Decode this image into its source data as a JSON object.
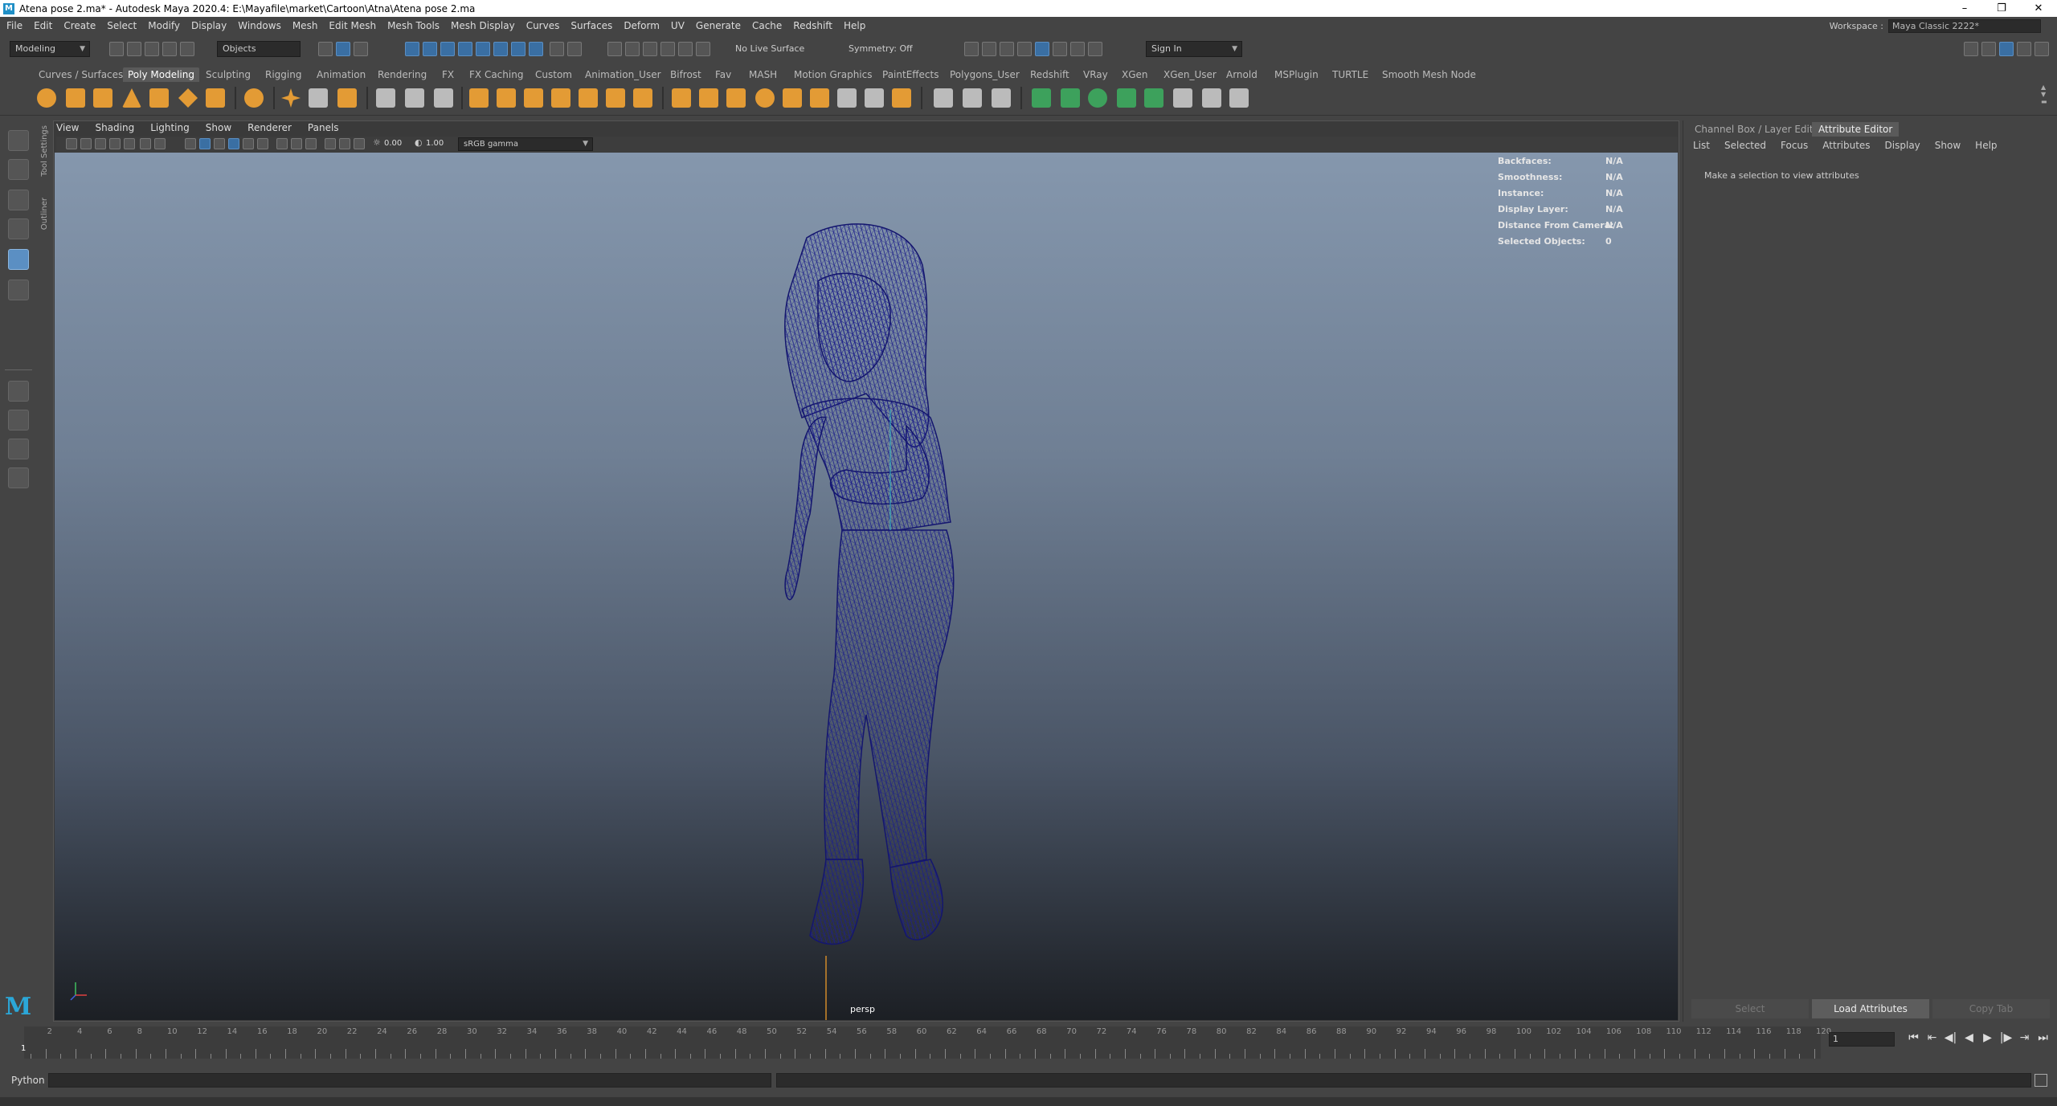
{
  "window": {
    "title": "Atena pose 2.ma* - Autodesk Maya 2020.4: E:\\Mayafile\\market\\Cartoon\\Atna\\Atena pose 2.ma",
    "logo": "M",
    "controls": [
      "–",
      "❐",
      "✕"
    ]
  },
  "menubar": {
    "items": [
      "File",
      "Edit",
      "Create",
      "Select",
      "Modify",
      "Display",
      "Windows",
      "Mesh",
      "Edit Mesh",
      "Mesh Tools",
      "Mesh Display",
      "Curves",
      "Surfaces",
      "Deform",
      "UV",
      "Generate",
      "Cache",
      "Redshift",
      "Help"
    ],
    "workspace_label": "Workspace :",
    "workspace_value": "Maya Classic 2222*"
  },
  "statusline": {
    "menuset": "Modeling",
    "selection_mode": "Objects",
    "live_surface": "No Live Surface",
    "symmetry": "Symmetry: Off",
    "sign_in": "Sign In"
  },
  "shelf": {
    "tabs": [
      "Curves / Surfaces",
      "Poly Modeling",
      "Sculpting",
      "Rigging",
      "Animation",
      "Rendering",
      "FX",
      "FX Caching",
      "Custom",
      "Animation_User",
      "Bifrost",
      "Fav",
      "MASH",
      "Motion Graphics",
      "PaintEffects",
      "Polygons_User",
      "Redshift",
      "VRay",
      "XGen",
      "XGen_User",
      "Arnold",
      "MSPlugin",
      "TURTLE",
      "Smooth Mesh Node"
    ],
    "active_tab": "Poly Modeling"
  },
  "sidetabs": [
    "Tool Settings",
    "Outliner"
  ],
  "viewport": {
    "menu": [
      "View",
      "Shading",
      "Lighting",
      "Show",
      "Renderer",
      "Panels"
    ],
    "exposure": "0.00",
    "gamma": "1.00",
    "color_space": "sRGB gamma",
    "camera": "persp",
    "hud": [
      {
        "key": "Backfaces:",
        "value": "N/A"
      },
      {
        "key": "Smoothness:",
        "value": "N/A"
      },
      {
        "key": "Instance:",
        "value": "N/A"
      },
      {
        "key": "Display Layer:",
        "value": "N/A"
      },
      {
        "key": "Distance From Camera:",
        "value": "N/A"
      },
      {
        "key": "Selected Objects:",
        "value": "0"
      }
    ],
    "wire_color": "#1d1f8a",
    "bg_top": "#8597ad",
    "bg_bottom": "#1c1f24"
  },
  "attribute_editor": {
    "tabs": [
      "Channel Box / Layer Editor",
      "Attribute Editor"
    ],
    "active_tab": "Attribute Editor",
    "menu": [
      "List",
      "Selected",
      "Focus",
      "Attributes",
      "Display",
      "Show",
      "Help"
    ],
    "message": "Make a selection to view attributes",
    "buttons": [
      "Select",
      "Load Attributes",
      "Copy Tab"
    ]
  },
  "timeslider": {
    "labels": [
      "2",
      "4",
      "6",
      "8",
      "10",
      "12",
      "14",
      "16",
      "18",
      "20",
      "22",
      "24",
      "26",
      "28",
      "30",
      "32",
      "34",
      "36",
      "38",
      "40",
      "42",
      "44",
      "46",
      "48",
      "50",
      "52",
      "54",
      "56",
      "58",
      "60",
      "62",
      "64",
      "66",
      "68",
      "70",
      "72",
      "74",
      "76",
      "78",
      "80",
      "82",
      "84",
      "86",
      "88",
      "90",
      "92",
      "94",
      "96",
      "98",
      "100",
      "102",
      "104",
      "106",
      "108",
      "110",
      "112",
      "114",
      "116",
      "118",
      "120"
    ],
    "current_frame": "1",
    "frame_field": "1",
    "playback": [
      "⏮",
      "⇤",
      "◀|",
      "◀",
      "▶",
      "|▶",
      "⇥",
      "⏭"
    ]
  },
  "commandline": {
    "label": "Python"
  }
}
